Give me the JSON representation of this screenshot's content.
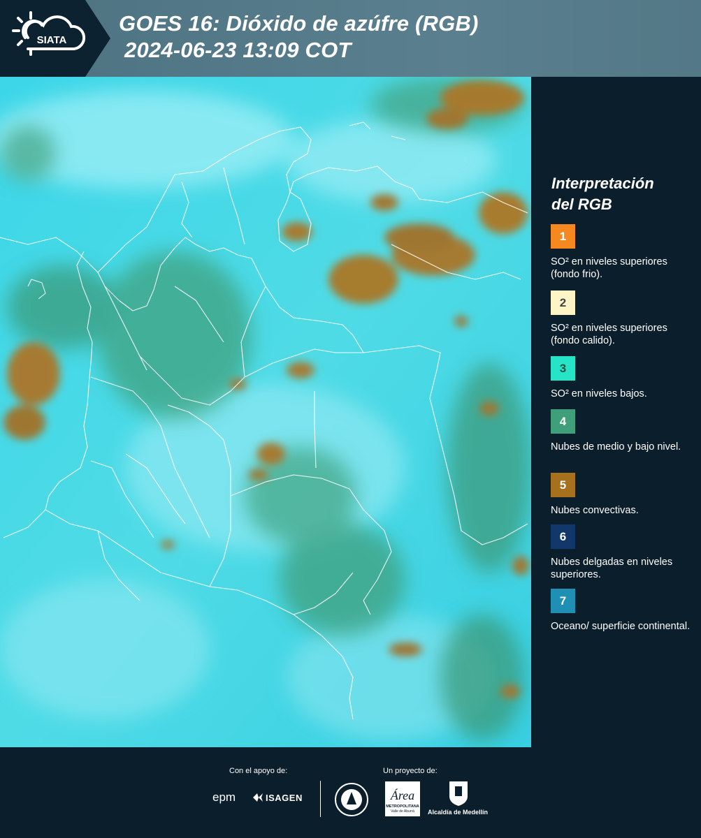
{
  "header": {
    "logo_text": "SIATA",
    "title_line1": "GOES 16: Dióxido de azúfre (RGB)",
    "title_line2": "2024-06-23 13:09 COT"
  },
  "legend": {
    "title_line1": "Interpretación",
    "title_line2": "del RGB",
    "items": [
      {
        "number": "1",
        "label": "SO² en niveles superiores (fondo frio).",
        "color": "#f5891f",
        "text_color": "#ffffff"
      },
      {
        "number": "2",
        "label": "SO² en niveles superiores (fondo calido).",
        "color": "#fdf5c5",
        "text_color": "#444444"
      },
      {
        "number": "3",
        "label": "SO² en niveles bajos.",
        "color": "#26e5c6",
        "text_color": "#1b4d44"
      },
      {
        "number": "4",
        "label": "Nubes de medio y bajo nivel.",
        "color": "#3e9f7a",
        "text_color": "#ffffff"
      },
      {
        "number": "5",
        "label": "Nubes convectivas.",
        "color": "#a6701c",
        "text_color": "#ffffff"
      },
      {
        "number": "6",
        "label": "Nubes delgadas en niveles superiores.",
        "color": "#12386b",
        "text_color": "#ffffff"
      },
      {
        "number": "7",
        "label": "Oceano/ superficie continental.",
        "color": "#1f8fb4",
        "text_color": "#ffffff"
      }
    ]
  },
  "footer": {
    "support_caption": "Con el apoyo de:",
    "project_caption": "Un proyecto de:",
    "epm_logo": "epm",
    "isagen_logo": "ISAGEN",
    "area_logo_main": "Área",
    "area_logo_sub1": "METROPOLITANA",
    "area_logo_sub2": "Valle de Aburrá",
    "alcaldia_logo": "Alcaldía de Medellín"
  }
}
